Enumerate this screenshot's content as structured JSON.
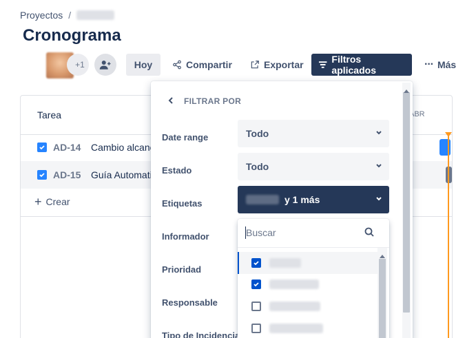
{
  "breadcrumb": {
    "root": "Proyectos",
    "separator": "/"
  },
  "page": {
    "title": "Cronograma"
  },
  "toolbar": {
    "avatar_overflow": "+1",
    "today_label": "Hoy",
    "share_label": "Compartir",
    "export_label": "Exportar",
    "filters_label": "Filtros aplicados",
    "more_label": "Más"
  },
  "timeline": {
    "column_header": "Tarea",
    "month_label": "ABR",
    "rows": [
      {
        "key": "AD-14",
        "summary": "Cambio alcanc"
      },
      {
        "key": "AD-15",
        "summary": "Guía Automati"
      }
    ],
    "create_label": "Crear"
  },
  "filter_panel": {
    "title": "FILTRAR POR",
    "fields": {
      "date_range": {
        "label": "Date range",
        "value": "Todo"
      },
      "estado": {
        "label": "Estado",
        "value": "Todo"
      },
      "etiquetas": {
        "label": "Etiquetas",
        "value_suffix": "y 1 más"
      },
      "informador": {
        "label": "Informador"
      },
      "prioridad": {
        "label": "Prioridad"
      },
      "responsable": {
        "label": "Responsable"
      },
      "tipo_incidencia": {
        "label": "Tipo de Incidencia"
      }
    },
    "dropdown": {
      "search_placeholder": "Buscar",
      "options": [
        {
          "checked": true
        },
        {
          "checked": true
        },
        {
          "checked": false
        },
        {
          "checked": false
        }
      ]
    }
  },
  "colors": {
    "primary_dark": "#253858",
    "accent_blue": "#0052cc",
    "checkbox_blue": "#2684ff",
    "today_orange": "#ff991f"
  }
}
